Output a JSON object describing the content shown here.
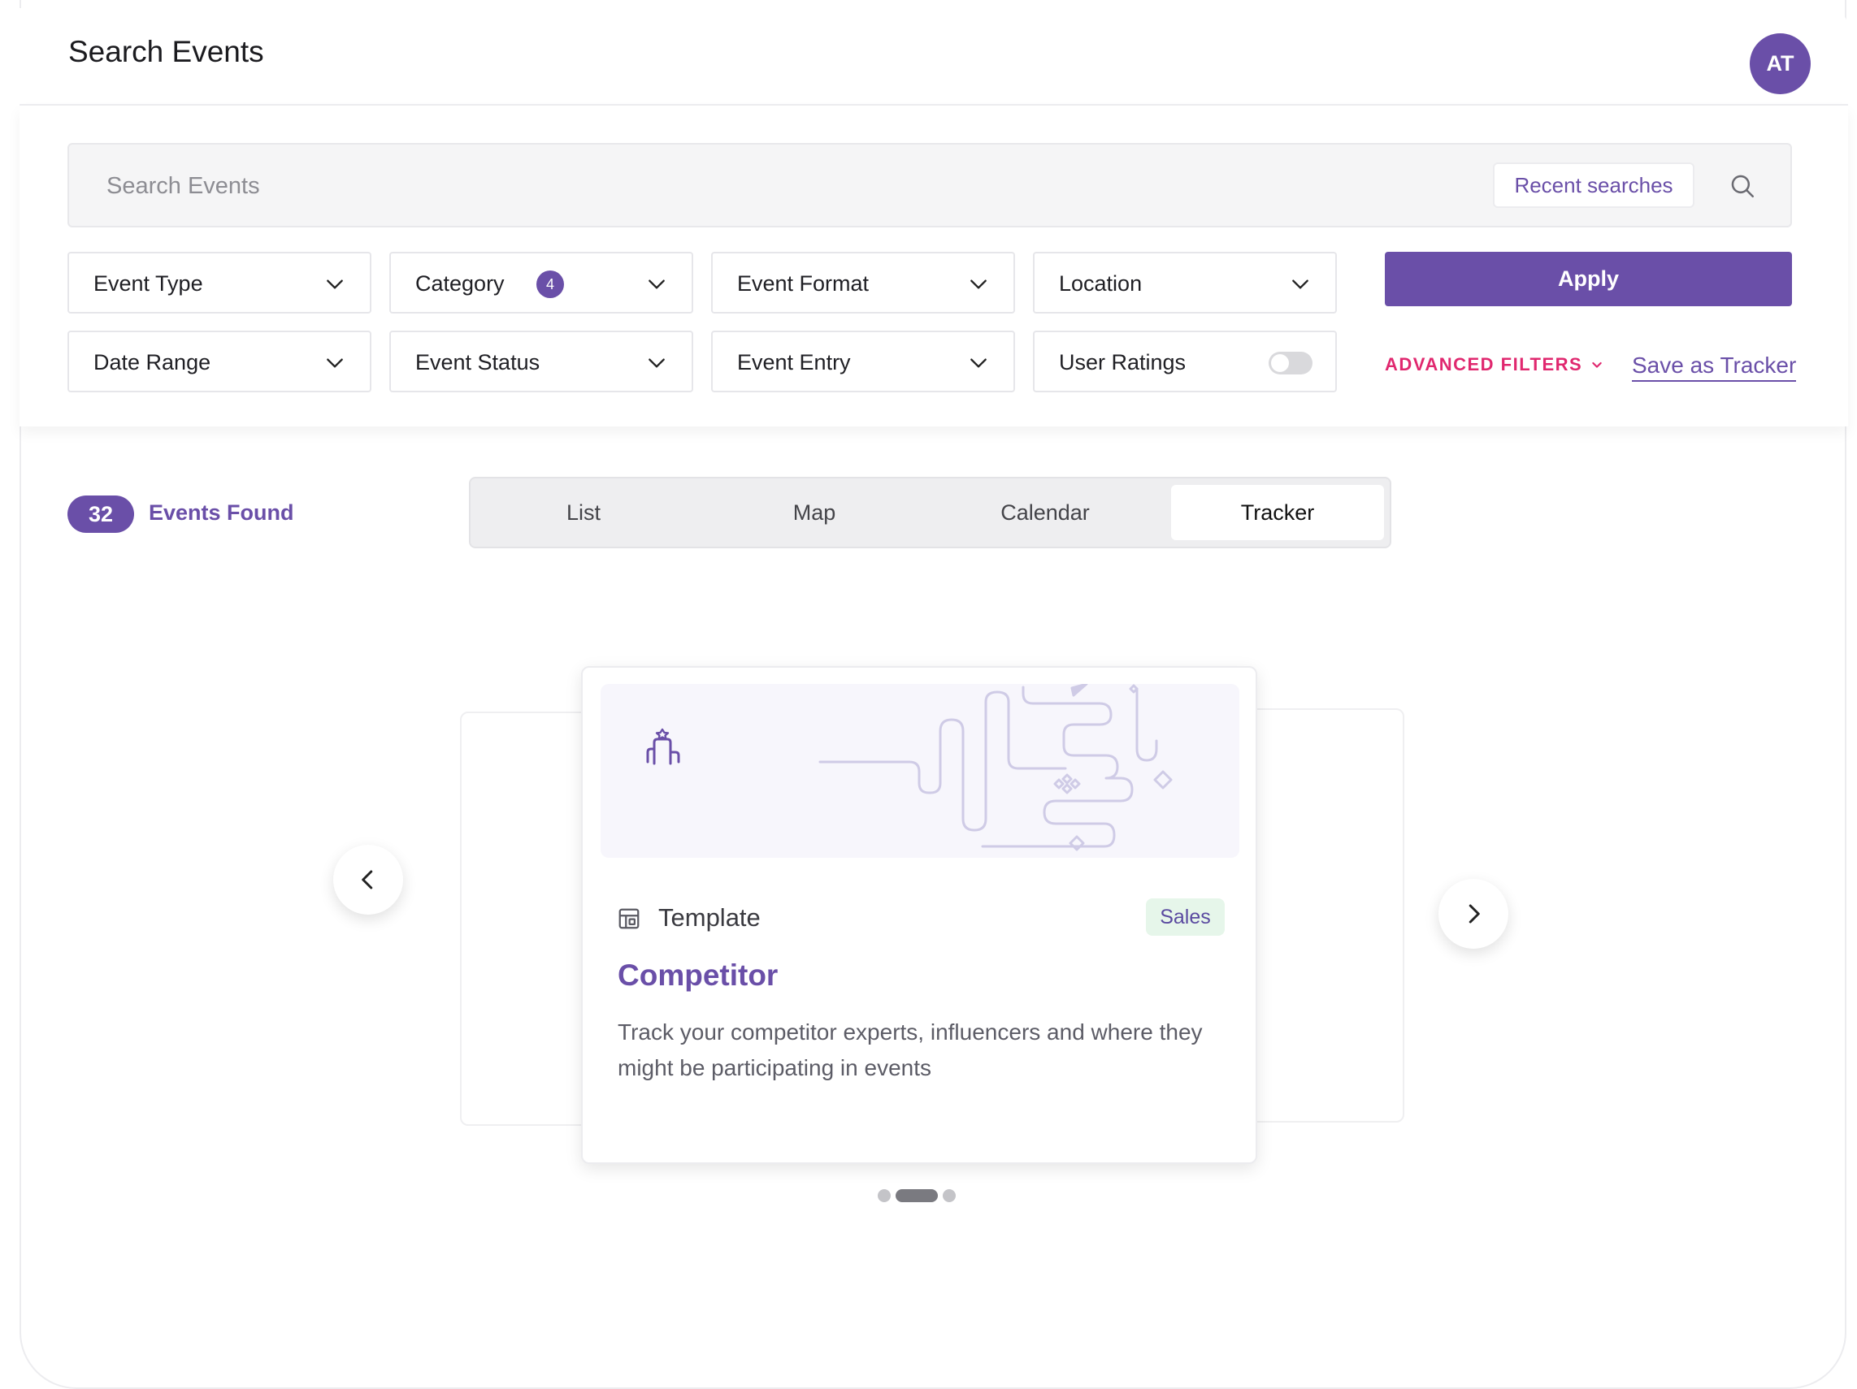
{
  "header": {
    "title": "Search Events",
    "avatar_initials": "AT"
  },
  "search": {
    "placeholder": "Search Events",
    "recent_label": "Recent searches"
  },
  "filters": {
    "row1": [
      {
        "label": "Event Type"
      },
      {
        "label": "Category",
        "badge": "4"
      },
      {
        "label": "Event Format"
      },
      {
        "label": "Location"
      }
    ],
    "row2": [
      {
        "label": "Date Range"
      },
      {
        "label": "Event Status"
      },
      {
        "label": "Event Entry"
      },
      {
        "label": "User Ratings",
        "toggle": false
      }
    ],
    "apply_label": "Apply",
    "advanced_label": "ADVANCED FILTERS",
    "save_tracker_label": "Save as Tracker"
  },
  "results": {
    "count": "32",
    "label": "Events Found"
  },
  "view_tabs": [
    {
      "label": "List",
      "active": false
    },
    {
      "label": "Map",
      "active": false
    },
    {
      "label": "Calendar",
      "active": false
    },
    {
      "label": "Tracker",
      "active": true
    }
  ],
  "card": {
    "type_label": "Template",
    "tag": "Sales",
    "title": "Competitor",
    "description": "Track your competitor experts, influencers and where they might be participating in events"
  },
  "carousel": {
    "total_dots": 3,
    "active_dot": 1
  },
  "colors": {
    "accent": "#6a4fa8",
    "advanced_filters": "#e0286f",
    "tag_bg": "#e6f6ea"
  }
}
